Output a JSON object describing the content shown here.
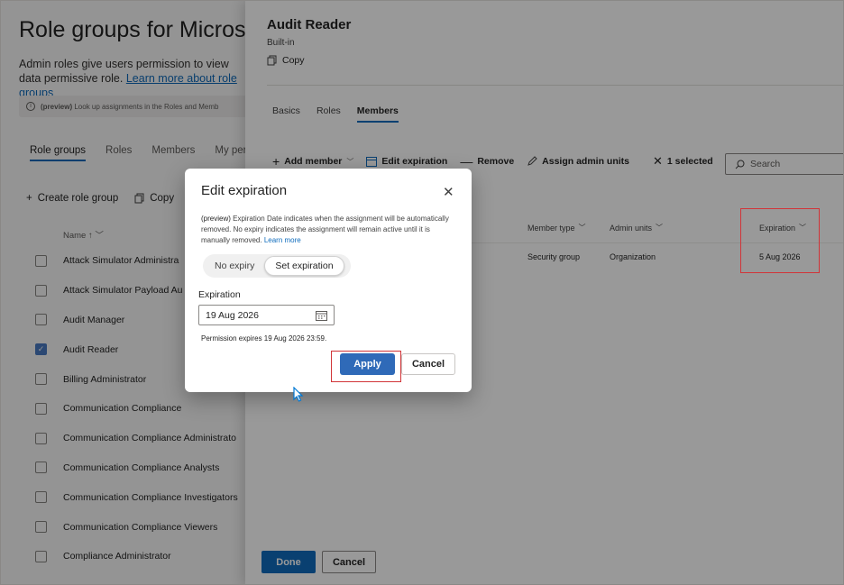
{
  "background": {
    "title": "Role groups for Micros",
    "description_text": "Admin roles give users permission to view data",
    "description_text2": "permissive role.",
    "description_link": "Learn more about role groups",
    "preview_bold": "(preview)",
    "preview_text": "Look up assignments in the Roles and Memb",
    "tabs": [
      "Role groups",
      "Roles",
      "Members",
      "My perm"
    ],
    "toolbar": {
      "create": "Create role group",
      "copy": "Copy"
    },
    "column_name": "Name",
    "rows": [
      {
        "name": "Attack Simulator Administra",
        "checked": false
      },
      {
        "name": "Attack Simulator Payload Au",
        "checked": false
      },
      {
        "name": "Audit Manager",
        "checked": false
      },
      {
        "name": "Audit Reader",
        "checked": true
      },
      {
        "name": "Billing Administrator",
        "checked": false
      },
      {
        "name": "Communication Compliance",
        "checked": false
      },
      {
        "name": "Communication Compliance Administrato",
        "checked": false
      },
      {
        "name": "Communication Compliance Analysts",
        "checked": false
      },
      {
        "name": "Communication Compliance Investigators",
        "checked": false
      },
      {
        "name": "Communication Compliance Viewers",
        "checked": false
      },
      {
        "name": "Compliance Administrator",
        "checked": false
      }
    ]
  },
  "panel": {
    "title": "Audit Reader",
    "subtitle": "Built-in",
    "copy": "Copy",
    "tabs": [
      "Basics",
      "Roles",
      "Members"
    ],
    "toolbar": {
      "add_member": "Add member",
      "edit_expiration": "Edit expiration",
      "remove": "Remove",
      "assign_admin_units": "Assign admin units",
      "selected": "1 selected",
      "search_placeholder": "Search"
    },
    "columns": {
      "member_type": "Member type",
      "admin_units": "Admin units",
      "expiration": "Expiration"
    },
    "row": {
      "member_type": "Security group",
      "admin_units": "Organization",
      "expiration": "5 Aug 2026"
    },
    "done": "Done",
    "cancel": "Cancel"
  },
  "dialog": {
    "title": "Edit expiration",
    "preview_bold": "(preview)",
    "description": "Expiration Date indicates when the assignment will be automatically removed. No expiry indicates the assignment will remain active until it is manually removed.",
    "learn_more": "Learn more",
    "segments": {
      "no_expiry": "No expiry",
      "set_expiration": "Set expiration",
      "selected": "Set expiration"
    },
    "expiration_label": "Expiration",
    "expiration_value": "19 Aug 2026",
    "note": "Permission expires 19 Aug 2026 23:59.",
    "apply": "Apply",
    "cancel": "Cancel"
  },
  "colors": {
    "accent": "#0f6cbd",
    "apply": "#2f6ab8",
    "highlight": "#d13438"
  }
}
